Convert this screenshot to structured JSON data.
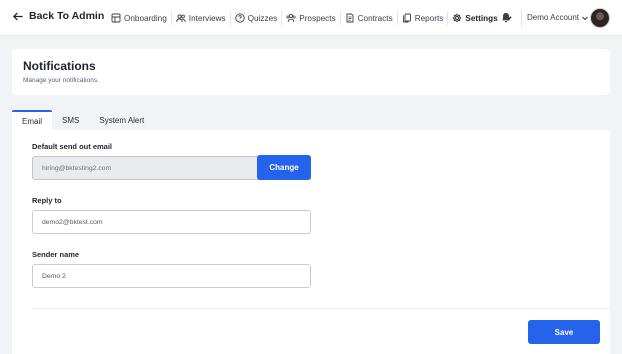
{
  "topbar": {
    "back_label": "Back To Admin",
    "nav": [
      {
        "label": "Onboarding",
        "icon": "onboarding-icon"
      },
      {
        "label": "Interviews",
        "icon": "interviews-icon"
      },
      {
        "label": "Quizzes",
        "icon": "quizzes-icon"
      },
      {
        "label": "Prospects",
        "icon": "prospects-icon"
      },
      {
        "label": "Contracts",
        "icon": "contracts-icon"
      },
      {
        "label": "Reports",
        "icon": "reports-icon"
      },
      {
        "label": "Settings",
        "icon": "gear-icon"
      }
    ],
    "account_label": "Demo Account"
  },
  "header": {
    "title": "Notifications",
    "subtitle": "Manage your notifications."
  },
  "tabs": [
    {
      "label": "Email"
    },
    {
      "label": "SMS"
    },
    {
      "label": "System Alert"
    }
  ],
  "form": {
    "send_out_label": "Default send out email",
    "send_out_value": "hiring@bktesting2.com",
    "change_label": "Change",
    "reply_label": "Reply to",
    "reply_value": "demo2@bktest.com",
    "sender_label": "Sender name",
    "sender_value": "Demo 2",
    "save_label": "Save"
  },
  "colors": {
    "accent": "#2563eb",
    "background": "#f1f3f6"
  }
}
